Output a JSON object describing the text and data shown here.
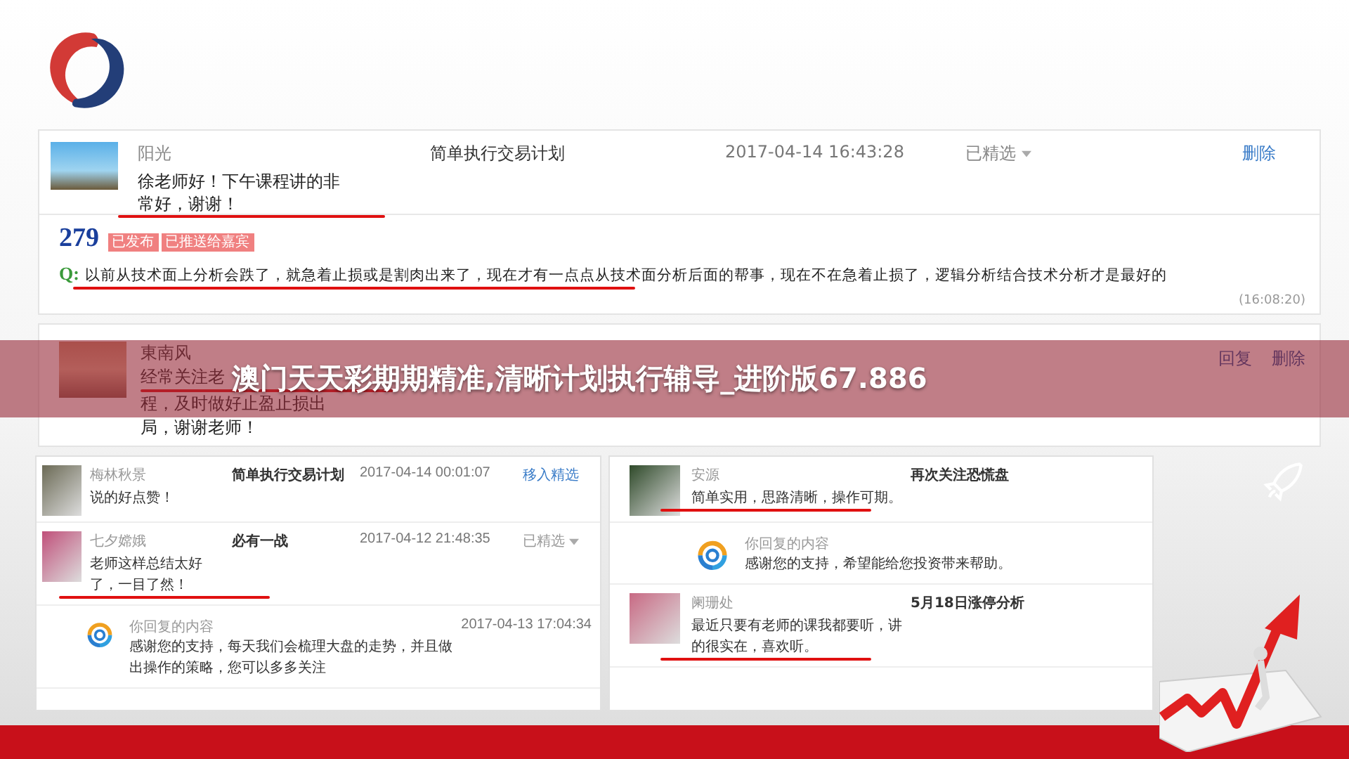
{
  "top_comment": {
    "user": "阳光",
    "text": "徐老师好！下午课程讲的非常好，谢谢！",
    "topic": "简单执行交易计划",
    "time": "2017-04-14 16:43:28",
    "action": {
      "kind": "dropdown",
      "label": "已精选"
    },
    "delete": "删除",
    "underlined": true
  },
  "question": {
    "count": "279",
    "tags": [
      "已发布",
      "已推送给嘉宾"
    ],
    "label": "Q:",
    "text": "以前从技术面上分析会跌了，就急着止损或是割肉出来了，现在才有一点点从技术面分析后面的帮事，现在不在急着止损了，逻辑分析结合技术分析才是最好的",
    "time": "(16:08:20)",
    "underlined": true
  },
  "partial_comment": {
    "user": "東南风",
    "lines": [
      "经常关注老",
      "程，及时做好止盈止损出",
      "局，谢谢老师！"
    ],
    "actions": [
      "回复",
      "删除"
    ],
    "underlined": true
  },
  "banner": {
    "title": "澳门天天彩期期精准,清晰计划执行辅导_进阶版67.886"
  },
  "left_card": {
    "comments": [
      {
        "user": "梅林秋景",
        "text": "说的好点赞！",
        "topic": "简单执行交易计划",
        "time": "2017-04-14 00:01:07",
        "action": {
          "kind": "link",
          "label": "移入精选"
        },
        "underlined": false
      },
      {
        "user": "七夕嫦娥",
        "text": "老师这样总结太好了，一目了然！",
        "topic": "必有一战",
        "time": "2017-04-12 21:48:35",
        "action": {
          "kind": "dropdown",
          "label": "已精选"
        },
        "underlined": true,
        "reply": {
          "label": "你回复的内容",
          "text": "感谢您的支持，每天我们会梳理大盘的走势，并且做出操作的策略，您可以多多关注",
          "time": "2017-04-13 17:04:34"
        }
      }
    ]
  },
  "right_card": {
    "comments": [
      {
        "user": "安源",
        "text": "简单实用，思路清晰，操作可期。",
        "topic": "再次关注恐慌盘",
        "underlined": true,
        "reply": {
          "label": "你回复的内容",
          "text": "感谢您的支持，希望能给您投资带来帮助。"
        }
      },
      {
        "user": "阑珊处",
        "text": "最近只要有老师的课我都要听，讲的很实在，喜欢听。",
        "topic": "5月18日涨停分析",
        "underlined": true
      }
    ]
  }
}
